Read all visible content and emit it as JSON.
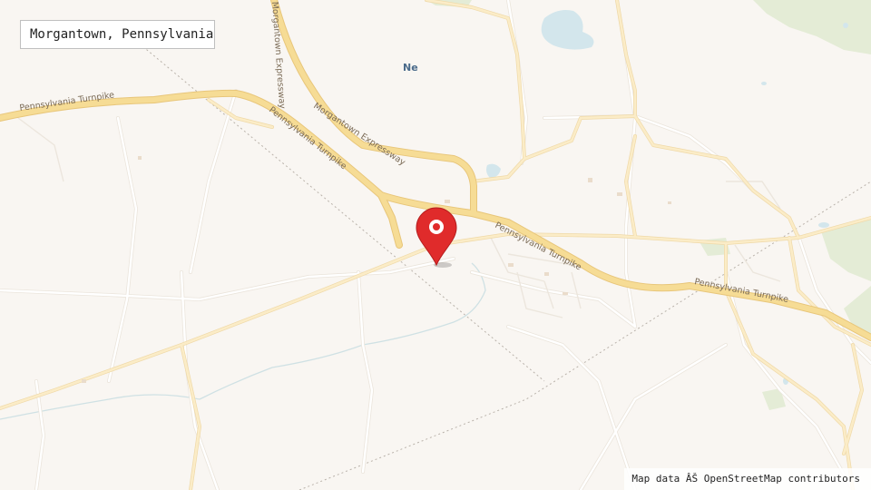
{
  "location": {
    "title": "Morgantown, Pennsylvania"
  },
  "map": {
    "attribution": "Map data ÂŠ OpenStreetMap contributors",
    "place_labels": [
      "Ne"
    ],
    "road_labels": [
      "Pennsylvania Turnpike",
      "Pennsylvania Turnpike",
      "Morgantown Expressway",
      "Pennsylvania Turnpike",
      "Pennsylvania Turnpike",
      "Morgantown Expressway"
    ],
    "marker_color": "#e02b2b",
    "land_color": "#f9f6f2",
    "highway_color": "#f6dc95",
    "minor_road_color": "#ffffff",
    "water_color": "#d3e6ec",
    "park_color": "#e4ecd6"
  }
}
